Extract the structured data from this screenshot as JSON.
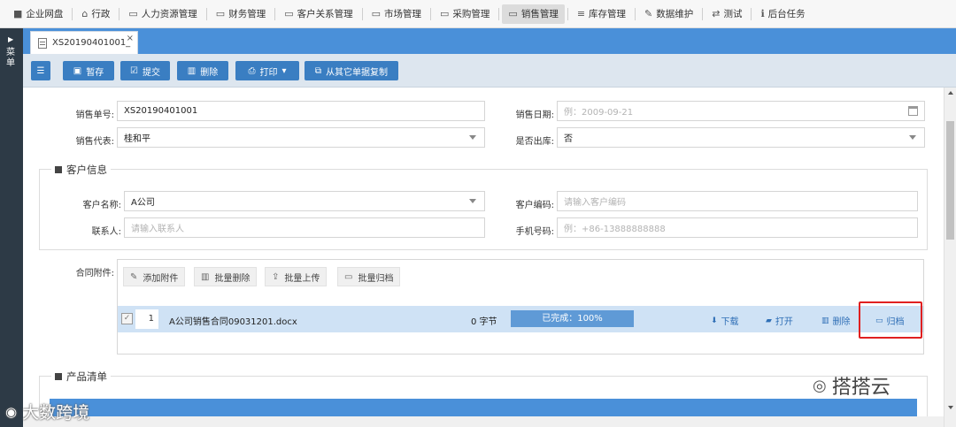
{
  "topnav": {
    "items": [
      {
        "label": "企业网盘",
        "icon": "folder-icon"
      },
      {
        "label": "行政",
        "icon": "bank-icon"
      },
      {
        "label": "人力资源管理",
        "icon": "folder-open-icon"
      },
      {
        "label": "财务管理",
        "icon": "folder-open-icon"
      },
      {
        "label": "客户关系管理",
        "icon": "folder-open-icon"
      },
      {
        "label": "市场管理",
        "icon": "folder-open-icon"
      },
      {
        "label": "采购管理",
        "icon": "folder-open-icon"
      },
      {
        "label": "销售管理",
        "icon": "folder-open-icon",
        "active": true
      },
      {
        "label": "库存管理",
        "icon": "database-icon"
      },
      {
        "label": "数据维护",
        "icon": "wrench-icon"
      },
      {
        "label": "测试",
        "icon": "shuffle-icon"
      },
      {
        "label": "后台任务",
        "icon": "info-icon"
      }
    ]
  },
  "leftbar": {
    "label": "菜单"
  },
  "tab": {
    "title": "XS20190401001_",
    "close": "×"
  },
  "toolbar": {
    "list_icon": "list-icon",
    "save": "暂存",
    "submit": "提交",
    "delete": "删除",
    "print": "打印",
    "copy": "从其它单据复制"
  },
  "form": {
    "order_no_label": "销售单号:",
    "order_no_value": "XS20190401001",
    "sale_date_label": "销售日期:",
    "sale_date_placeholder": "例：2009-09-21",
    "rep_label": "销售代表:",
    "rep_value": "桂和平",
    "outbound_label": "是否出库:",
    "outbound_value": "否"
  },
  "customer": {
    "section_title": "客户信息",
    "name_label": "客户名称:",
    "name_value": "A公司",
    "code_label": "客户编码:",
    "code_placeholder": "请输入客户编码",
    "contact_label": "联系人:",
    "contact_placeholder": "请输入联系人",
    "phone_label": "手机号码:",
    "phone_placeholder": "例：+86-13888888888"
  },
  "attachments": {
    "label": "合同附件:",
    "buttons": {
      "add": "添加附件",
      "batch_delete": "批量删除",
      "batch_upload": "批量上传",
      "batch_archive": "批量归档"
    },
    "rows": [
      {
        "index": "1",
        "filename": "A公司销售合同09031201.docx",
        "size": "0 字节",
        "progress_text": "已完成：100%",
        "progress": 1.0,
        "download": "下载",
        "open": "打开",
        "delete": "删除",
        "archive": "归档"
      }
    ]
  },
  "products": {
    "section_title": "产品清单"
  },
  "watermarks": {
    "left": "大数跨境",
    "right": "搭搭云"
  }
}
